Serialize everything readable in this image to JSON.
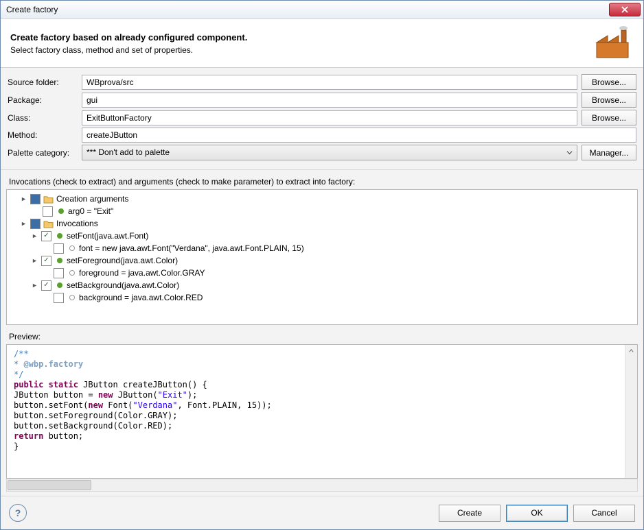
{
  "window": {
    "title": "Create factory"
  },
  "banner": {
    "heading": "Create factory based on already configured component.",
    "sub": "Select factory class, method and set of properties."
  },
  "form": {
    "sourceFolder": {
      "label": "Source folder:",
      "value": "WBprova/src",
      "browse": "Browse..."
    },
    "packageField": {
      "label": "Package:",
      "value": "gui",
      "browse": "Browse..."
    },
    "classField": {
      "label": "Class:",
      "value": "ExitButtonFactory",
      "browse": "Browse..."
    },
    "methodField": {
      "label": "Method:",
      "value": "createJButton"
    },
    "palette": {
      "label": "Palette category:",
      "value": "*** Don't add to palette",
      "manager": "Manager..."
    }
  },
  "treeHeader": "Invocations (check to extract) and arguments (check to make parameter) to extract into factory:",
  "tree": {
    "creationArgs": "Creation arguments",
    "arg0": "arg0 = \"Exit\"",
    "invocations": "Invocations",
    "setFont": "setFont(java.awt.Font)",
    "fontVal": "font = new java.awt.Font(\"Verdana\", java.awt.Font.PLAIN, 15)",
    "setForeground": "setForeground(java.awt.Color)",
    "fgVal": "foreground = java.awt.Color.GRAY",
    "setBackground": "setBackground(java.awt.Color)",
    "bgVal": "background = java.awt.Color.RED"
  },
  "previewLabel": "Preview:",
  "code": {
    "l1": "/**",
    "l2": " * ",
    "l2tag": "@wbp.factory",
    "l3": " */",
    "l4a": "public static",
    "l4b": " JButton createJButton() {",
    "l5a": "    JButton button = ",
    "l5b": "new",
    "l5c": " JButton(",
    "l5d": "\"Exit\"",
    "l5e": ");",
    "l6a": "    button.setFont(",
    "l6b": "new",
    "l6c": " Font(",
    "l6d": "\"Verdana\"",
    "l6e": ", Font.PLAIN, 15));",
    "l7": "    button.setForeground(Color.GRAY);",
    "l8": "    button.setBackground(Color.RED);",
    "l9a": "    ",
    "l9b": "return",
    "l9c": " button;",
    "l10": "}"
  },
  "footer": {
    "create": "Create",
    "ok": "OK",
    "cancel": "Cancel"
  }
}
